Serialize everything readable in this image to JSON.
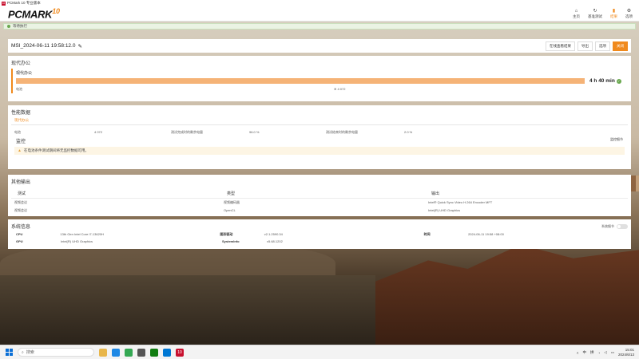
{
  "titlebar": {
    "title": "PCMark 10 专业版本"
  },
  "brand": {
    "name": "PCMARK",
    "version": "10"
  },
  "nav": [
    {
      "label": "主页",
      "icon": "home-icon",
      "glyph": "⌂"
    },
    {
      "label": "基准测试",
      "icon": "refresh-icon",
      "glyph": "↻"
    },
    {
      "label": "结果",
      "icon": "bar-chart-icon",
      "glyph": "▮"
    },
    {
      "label": "选项",
      "icon": "gear-icon",
      "glyph": "⚙"
    }
  ],
  "notice": {
    "text": "等待执行"
  },
  "result_header": {
    "name": "MSI_2024-06-11 19:58:12.0",
    "buttons": {
      "compare": "在线查看结果",
      "export": "导出",
      "options": "选项",
      "close": "关闭"
    }
  },
  "office": {
    "section_title": "现代办公",
    "test_name": "现代办公",
    "duration": "4 h 40 min",
    "score_label": "电池",
    "score_value": "4 072",
    "fill_percent": 100
  },
  "perf": {
    "section_title": "性能数据",
    "tab": "现代办公",
    "row": {
      "k1": "电池",
      "v1": "4 072",
      "k2": "测试完成时的剩余电量",
      "v2": "96.0 %",
      "k3": "测试结束时的剩余电量",
      "v3": "2.0 %"
    },
    "monitor_title": "监控",
    "monitor_link": "监控细节",
    "warning": "在电池条件测试期间将无监控数据可用。"
  },
  "other_output": {
    "section_title": "其他输出",
    "columns": [
      "测试",
      "类型",
      "输出"
    ],
    "rows": [
      [
        "视频会议",
        "视频编码器",
        "Intel® Quick Sync Video H.264 Encoder MFT"
      ],
      [
        "视频会议",
        "OpenCL",
        "Intel(R) UHD Graphics"
      ]
    ]
  },
  "system": {
    "section_title": "系统信息",
    "toggle_label": "系统细节",
    "rows": [
      {
        "k1": "CPU",
        "v1": "13th Gen Intel Core i7-13620H",
        "k2": "图形驱动",
        "v2": "v2.1.2590.34",
        "k3": "时间",
        "v3": "2024-06-11 19:58 +08:00"
      },
      {
        "k1": "GPU",
        "v1": "Intel(R) UHD Graphics",
        "k2": "SystemInfo",
        "v2": "v5.68.1202",
        "k3": "",
        "v3": ""
      }
    ]
  },
  "taskbar": {
    "search_placeholder": "搜索",
    "clock_time": "15:01",
    "clock_date": "2024/6/13",
    "tray_lang": "中",
    "tray_mode": "拼"
  },
  "colors": {
    "accent": "#f08a1d",
    "success": "#6aa84f",
    "bar": "#f5b377"
  }
}
